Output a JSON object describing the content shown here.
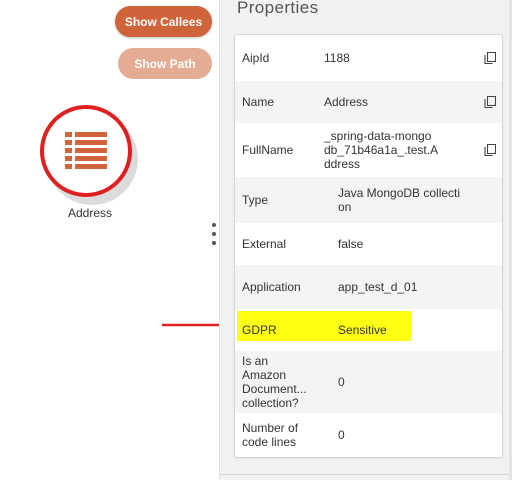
{
  "toolbar": {
    "show_callees_label": "Show Callees",
    "show_path_label": "Show Path"
  },
  "graph": {
    "node": {
      "label": "Address",
      "icon": "table-list-icon",
      "selected_ring_color": "#e02020",
      "icon_color": "#cf643a"
    },
    "annotation_arrow_color": "#e02020"
  },
  "properties": {
    "title": "Properties",
    "rows": [
      {
        "key": "AipId",
        "value": "1188",
        "copyable": true
      },
      {
        "key": "Name",
        "value": "Address",
        "copyable": true
      },
      {
        "key": "FullName",
        "value_lines": [
          "_spring-data-mongo",
          "db_71b46a1a_.test.A",
          "ddress"
        ],
        "copyable": true
      },
      {
        "key": "Type",
        "value_lines": [
          "Java MongoDB collecti",
          "on"
        ]
      },
      {
        "key": "External",
        "value": "false"
      },
      {
        "key": "Application",
        "value": "app_test_d_01"
      },
      {
        "key": "GDPR",
        "value": "Sensitive",
        "highlight": "#ffff14"
      },
      {
        "key_lines": [
          "Is an",
          "Amazon",
          "Document...",
          "collection?"
        ],
        "value": "0"
      },
      {
        "key_lines": [
          "Number of",
          "code lines"
        ],
        "value": "0"
      }
    ]
  },
  "colors": {
    "accent": "#cf643a",
    "accent_disabled": "#e4ac93",
    "panel_bg": "#f2f2f2",
    "highlight": "#ffff14"
  }
}
